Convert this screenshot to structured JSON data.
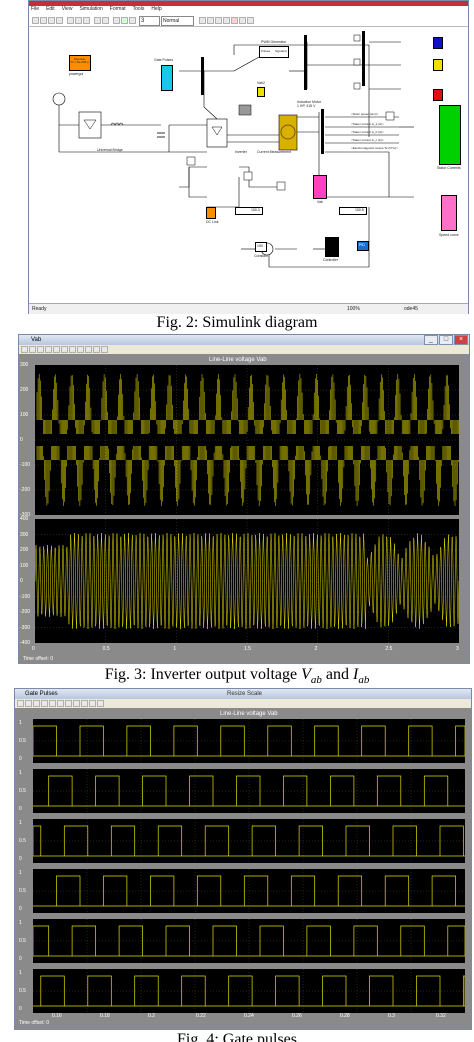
{
  "fig2": {
    "menu": [
      "File",
      "Edit",
      "View",
      "Simulation",
      "Format",
      "Tools",
      "Help"
    ],
    "toolbar": {
      "stop_time": "3",
      "mode": "Normal"
    },
    "blocks": {
      "powergui": "Discrete,\nTs = 5e-006 s.",
      "powergui_label": "powergui",
      "gate_pulses": "Gate Pulses",
      "pwm_generator": "PWM Generator",
      "pulses": "Pulses",
      "signal": "Signal(s)",
      "vabc": "Vab2",
      "induction_motor": "Induction Motor\n1 HP, 415 V",
      "rotor_speed": "<Rotor speed (wm)>",
      "stator_a": "<Stator current is_a (A)>",
      "stator_b": "<Stator current is_b (A)>",
      "stator_c": "<Stator current is_c (A)>",
      "torque": "<Electromagnetic torque Te (N*m)>",
      "universal_bridge": "Universal Bridge",
      "inverter": "Inverter",
      "current_measurement": "Current Measurement",
      "dc_link": "DC Link",
      "display1": "150.3",
      "display2": "150.8",
      "vab": "Vab",
      "stator_currents": "Stator Currents",
      "speed_curve": "Speed curve",
      "constant": "Constant",
      "constant_val": "150",
      "controller": "Controller",
      "brake": "Brake",
      "pid": "PID"
    },
    "status": {
      "left": "Ready",
      "zoom": "100%",
      "solver": "ode45"
    },
    "caption": "Fig. 2: Simulink diagram"
  },
  "fig3": {
    "window_title": "Vab",
    "plot_title": "Line-Line voltage Vab",
    "top_yticks": [
      "300",
      "200",
      "100",
      "0",
      "-100",
      "-200",
      "-300"
    ],
    "bottom_yticks": [
      "400",
      "300",
      "200",
      "100",
      "0",
      "-100",
      "-200",
      "-300",
      "-400"
    ],
    "xticks": [
      "0",
      "0.5",
      "1",
      "1.5",
      "2",
      "2.5",
      "3"
    ],
    "time_offset": "Time offset:  0",
    "caption_prefix": "Fig. 3: Inverter output voltage ",
    "caption_v": "V",
    "caption_v_sub": "ab",
    "caption_mid": " and ",
    "caption_i": "I",
    "caption_i_sub": "ab"
  },
  "fig4": {
    "window_title": "Gate Pulses",
    "title_bar_center": "Resize Scale",
    "plot_title": "Line-Line voltage Vab",
    "yticks": [
      "1",
      "0.5",
      "0"
    ],
    "xticks": [
      "0.16",
      "0.18",
      "0.2",
      "0.22",
      "0.24",
      "0.26",
      "0.28",
      "0.3",
      "0.32"
    ],
    "time_offset": "Time offset:  0",
    "caption": "Fig. 4: Gate pulses"
  },
  "colors": {
    "scope_bg": "#000000",
    "trace": "#e8e000",
    "powergui": "#ff8c00",
    "gate_cyan": "#18c8e8",
    "motor_gold": "#d8b000",
    "scope_green": "#00d000",
    "scope_pink": "#ff40c0",
    "scope_pink2": "#ff70c8",
    "blue_block": "#1010c8",
    "yellow_block": "#f0e000",
    "red_block": "#e01010"
  }
}
